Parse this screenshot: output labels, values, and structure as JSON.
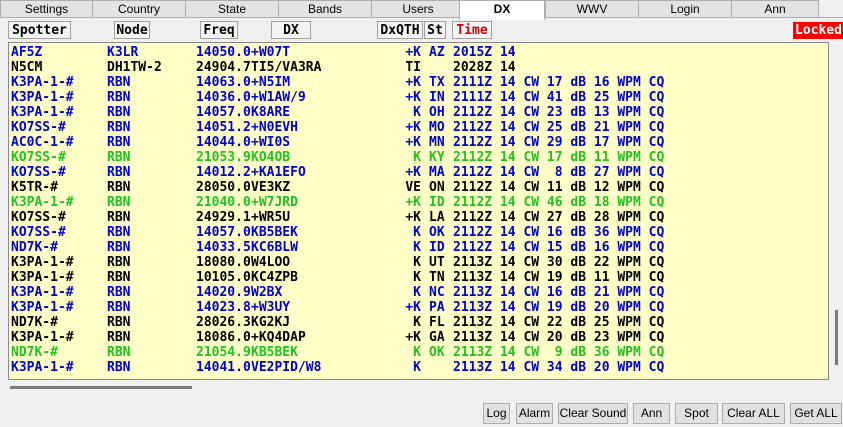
{
  "tabs": [
    "Settings",
    "Country",
    "State",
    "Bands",
    "Users",
    "DX",
    "WWV",
    "Login",
    "Ann"
  ],
  "active_tab": "DX",
  "columns": {
    "spotter": "Spotter",
    "node": "Node",
    "freq": "Freq",
    "dx": "DX",
    "dxqth": "DxQTH",
    "st": "St",
    "time": "Time"
  },
  "locked_label": "Locked",
  "rows": [
    {
      "color": "blue",
      "spotter": "AF5Z",
      "node": "K3LR",
      "freq": "14050.0",
      "dx": "+W07T",
      "dxqth": "+K",
      "st": "AZ",
      "rest": "2015Z 14"
    },
    {
      "color": "black",
      "spotter": "N5CM",
      "node": "DH1TW-2",
      "freq": "24904.7",
      "dx": "TI5/VA3RA",
      "dxqth": "TI",
      "st": "",
      "rest": "2028Z 14"
    },
    {
      "color": "blue",
      "spotter": "K3PA-1-#",
      "node": "RBN",
      "freq": "14063.0",
      "dx": "+N5IM",
      "dxqth": "+K",
      "st": "TX",
      "rest": "2111Z 14 CW 17 dB 16 WPM CQ"
    },
    {
      "color": "blue",
      "spotter": "K3PA-1-#",
      "node": "RBN",
      "freq": "14036.0",
      "dx": "+W1AW/9",
      "dxqth": "+K",
      "st": "IN",
      "rest": "2111Z 14 CW 41 dB 25 WPM CQ"
    },
    {
      "color": "blue",
      "spotter": "K3PA-1-#",
      "node": "RBN",
      "freq": "14057.0",
      "dx": "K8ARE",
      "dxqth": "K",
      "st": "OH",
      "rest": "2112Z 14 CW 23 dB 13 WPM CQ"
    },
    {
      "color": "blue",
      "spotter": "KO7SS-#",
      "node": "RBN",
      "freq": "14051.2",
      "dx": "+N0EVH",
      "dxqth": "+K",
      "st": "MO",
      "rest": "2112Z 14 CW 25 dB 21 WPM CQ"
    },
    {
      "color": "blue",
      "spotter": "AC0C-1-#",
      "node": "RBN",
      "freq": "14044.0",
      "dx": "+WI0S",
      "dxqth": "+K",
      "st": "MN",
      "rest": "2112Z 14 CW 29 dB 17 WPM CQ"
    },
    {
      "color": "green",
      "spotter": "KO7SS-#",
      "node": "RBN",
      "freq": "21053.9",
      "dx": "KO4OB",
      "dxqth": "K",
      "st": "KY",
      "rest": "2112Z 14 CW 17 dB 11 WPM CQ"
    },
    {
      "color": "blue",
      "spotter": "KO7SS-#",
      "node": "RBN",
      "freq": "14012.2",
      "dx": "+KA1EFO",
      "dxqth": "+K",
      "st": "MA",
      "rest": "2112Z 14 CW  8 dB 27 WPM CQ"
    },
    {
      "color": "black",
      "spotter": "K5TR-#",
      "node": "RBN",
      "freq": "28050.0",
      "dx": "VE3KZ",
      "dxqth": "VE",
      "st": "ON",
      "rest": "2112Z 14 CW 11 dB 12 WPM CQ"
    },
    {
      "color": "green",
      "spotter": "K3PA-1-#",
      "node": "RBN",
      "freq": "21040.0",
      "dx": "+W7JRD",
      "dxqth": "+K",
      "st": "ID",
      "rest": "2112Z 14 CW 46 dB 18 WPM CQ"
    },
    {
      "color": "black",
      "spotter": "KO7SS-#",
      "node": "RBN",
      "freq": "24929.1",
      "dx": "+WR5U",
      "dxqth": "+K",
      "st": "LA",
      "rest": "2112Z 14 CW 27 dB 28 WPM CQ"
    },
    {
      "color": "blue",
      "spotter": "KO7SS-#",
      "node": "RBN",
      "freq": "14057.0",
      "dx": "KB5BEK",
      "dxqth": "K",
      "st": "OK",
      "rest": "2112Z 14 CW 16 dB 36 WPM CQ"
    },
    {
      "color": "blue",
      "spotter": "ND7K-#",
      "node": "RBN",
      "freq": "14033.5",
      "dx": "KC6BLW",
      "dxqth": "K",
      "st": "ID",
      "rest": "2112Z 14 CW 15 dB 16 WPM CQ"
    },
    {
      "color": "black",
      "spotter": "K3PA-1-#",
      "node": "RBN",
      "freq": "18080.0",
      "dx": "W4LOO",
      "dxqth": "K",
      "st": "UT",
      "rest": "2113Z 14 CW 30 dB 22 WPM CQ"
    },
    {
      "color": "black",
      "spotter": "K3PA-1-#",
      "node": "RBN",
      "freq": "10105.0",
      "dx": "KC4ZPB",
      "dxqth": "K",
      "st": "TN",
      "rest": "2113Z 14 CW 19 dB 11 WPM CQ"
    },
    {
      "color": "blue",
      "spotter": "K3PA-1-#",
      "node": "RBN",
      "freq": "14020.9",
      "dx": "W2BX",
      "dxqth": "K",
      "st": "NC",
      "rest": "2113Z 14 CW 16 dB 21 WPM CQ"
    },
    {
      "color": "blue",
      "spotter": "K3PA-1-#",
      "node": "RBN",
      "freq": "14023.8",
      "dx": "+W3UY",
      "dxqth": "+K",
      "st": "PA",
      "rest": "2113Z 14 CW 19 dB 20 WPM CQ"
    },
    {
      "color": "black",
      "spotter": "ND7K-#",
      "node": "RBN",
      "freq": "28026.3",
      "dx": "KG2KJ",
      "dxqth": "K",
      "st": "FL",
      "rest": "2113Z 14 CW 22 dB 25 WPM CQ"
    },
    {
      "color": "black",
      "spotter": "K3PA-1-#",
      "node": "RBN",
      "freq": "18086.0",
      "dx": "+KQ4DAP",
      "dxqth": "+K",
      "st": "GA",
      "rest": "2113Z 14 CW 20 dB 23 WPM CQ"
    },
    {
      "color": "green",
      "spotter": "ND7K-#",
      "node": "RBN",
      "freq": "21054.9",
      "dx": "KB5BEK",
      "dxqth": "K",
      "st": "OK",
      "rest": "2113Z 14 CW  9 dB 36 WPM CQ"
    },
    {
      "color": "blue",
      "spotter": "K3PA-1-#",
      "node": "RBN",
      "freq": "14041.0",
      "dx": "VE2PID/W8",
      "dxqth": "K",
      "st": "",
      "rest": "2113Z 14 CW 34 dB 20 WPM CQ"
    }
  ],
  "buttons": [
    "Log",
    "Alarm",
    "Clear Sound",
    "Ann",
    "Spot",
    "Clear ALL",
    "Get ALL"
  ]
}
